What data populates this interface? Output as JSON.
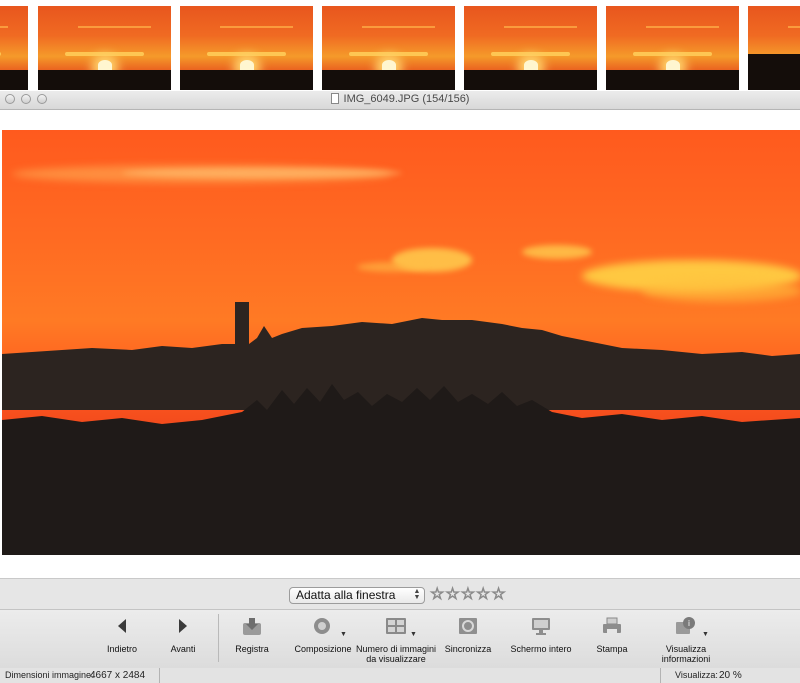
{
  "window": {
    "title": "IMG_6049.JPG (154/156)"
  },
  "filmstrip": {
    "thumbnails": [
      {
        "kind": "sunset"
      },
      {
        "kind": "sunset"
      },
      {
        "kind": "sunset"
      },
      {
        "kind": "sunset"
      },
      {
        "kind": "sunset"
      },
      {
        "kind": "sunset"
      },
      {
        "kind": "sunset"
      }
    ]
  },
  "viewer": {
    "zoom_select": "Adatta alla finestra",
    "rating_stars": 5,
    "rating_value": 0
  },
  "toolbar": {
    "back": "Indietro",
    "forward": "Avanti",
    "save": "Registra",
    "compose": "Composizione",
    "num_images_line1": "Numero di immagini",
    "num_images_line2": "da visualizzare",
    "sync": "Sincronizza",
    "fullscreen": "Schermo intero",
    "print": "Stampa",
    "info_line1": "Visualizza",
    "info_line2": "informazioni"
  },
  "status": {
    "dimensions_label": "Dimensioni immagine:",
    "dimensions_value": "4667 x 2484",
    "zoom_label": "Visualizza:",
    "zoom_value": "20 %"
  },
  "colors": {
    "sky_orange": "#ff6a22",
    "cloud_yellow": "#ffd24a",
    "silhouette": "#1e1916"
  }
}
